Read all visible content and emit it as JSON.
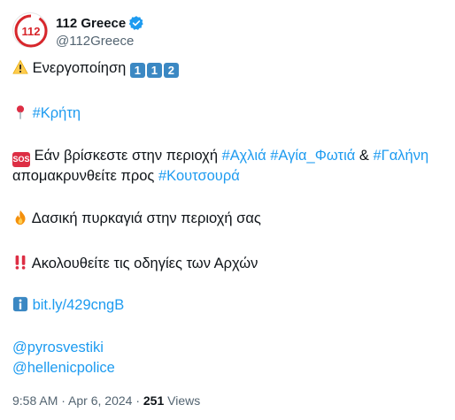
{
  "author": {
    "display_name": "112 Greece",
    "handle": "@112Greece",
    "avatar_text": "112"
  },
  "tweet": {
    "line1_text": "Ενεργοποίηση",
    "line1_keys": [
      "1",
      "1",
      "2"
    ],
    "line2_hashtag": "#Κρήτη",
    "line3_sos": "SOS",
    "line3_text": "Εάν βρίσκεστε στην περιοχή",
    "line3_tag1": "#Αχλιά",
    "line3_tag2": "#Αγία_Φωτιά",
    "line3_amp": "&",
    "line3_tag3": "#Γαλήνη",
    "line4_text": "απομακρυνθείτε προς",
    "line4_tag": "#Κουτσουρά",
    "line5_text": "Δασική πυρκαγιά στην περιοχή σας",
    "line6_text": "Ακολουθείτε τις οδηγίες των Αρχών",
    "line7_link": "bit.ly/429cngB",
    "mention1": "@pyrosvestiki",
    "mention2": "@hellenicpolice"
  },
  "meta": {
    "time": "9:58 AM",
    "sep1": " · ",
    "date": "Apr 6, 2024",
    "sep2": " · ",
    "views_count": "251",
    "views_label": "Views"
  },
  "colors": {
    "link": "#1d9bf0",
    "text": "#0f1419",
    "secondary": "#536471",
    "brand_red": "#d7262b"
  },
  "icons": [
    "warning-icon",
    "keycap-icon",
    "pin-icon",
    "sos-icon",
    "fire-icon",
    "double-exclamation-icon",
    "info-icon",
    "verified-badge-icon"
  ]
}
